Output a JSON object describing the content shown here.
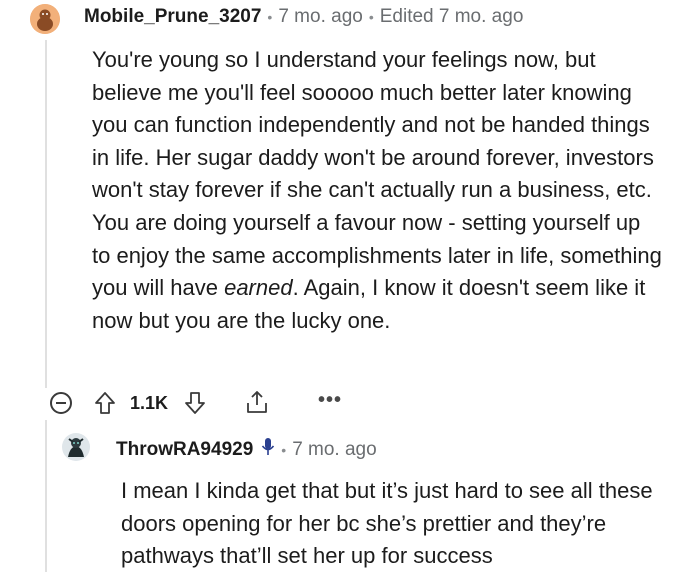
{
  "comment": {
    "username": "Mobile_Prune_3207",
    "time": "7 mo. ago",
    "edited": "Edited 7 mo. ago",
    "text_before_em": "You're young so I understand your feelings now, but believe me you'll feel sooooo much better later knowing you can function independently and not be handed things in life. Her sugar daddy won't be around forever, investors won't stay forever if she can't actually run a business, etc. You are doing yourself a favour now - setting yourself up to enjoy the same accomplishments later in life, something you will have ",
    "text_em": "earned",
    "text_after_em": ". Again, I know it doesn't seem like it now but you are the lucky one.",
    "votes": "1.1K",
    "more_label": "•••"
  },
  "reply": {
    "username": "ThrowRA94929",
    "time": "7 mo. ago",
    "text": "I mean I kinda get that but it’s just hard to see all these doors opening for her bc she’s prettier and they’re pathways that’ll set her up for success"
  },
  "icons": {
    "collapse": "collapse-icon",
    "upvote": "upvote-icon",
    "downvote": "downvote-icon",
    "share": "share-icon",
    "more": "more-icon",
    "mic": "microphone-icon"
  },
  "colors": {
    "text": "#1c1c1c",
    "meta": "#6a6d70",
    "thread": "#e0e0e0",
    "mic": "#2a3f8f"
  }
}
